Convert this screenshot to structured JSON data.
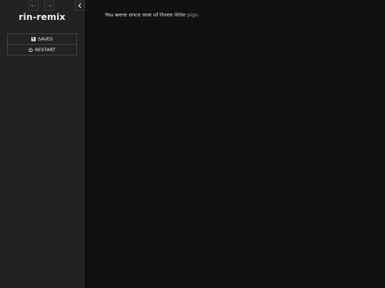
{
  "sidebar": {
    "story_title": "rin-remix",
    "history": {
      "back_icon": "arrow-left-icon",
      "forward_icon": "arrow-right-icon"
    },
    "stow_icon": "chevron-left-icon",
    "menu": [
      {
        "label": "SAVES",
        "icon": "save-icon"
      },
      {
        "label": "RESTART",
        "icon": "power-icon"
      }
    ]
  },
  "passage": {
    "text_before": "You were once one of three little ",
    "link_text": "pigs",
    "text_after": "."
  },
  "colors": {
    "sidebar_bg": "#222222",
    "main_bg": "#111111",
    "link": "#6aa1d8"
  }
}
